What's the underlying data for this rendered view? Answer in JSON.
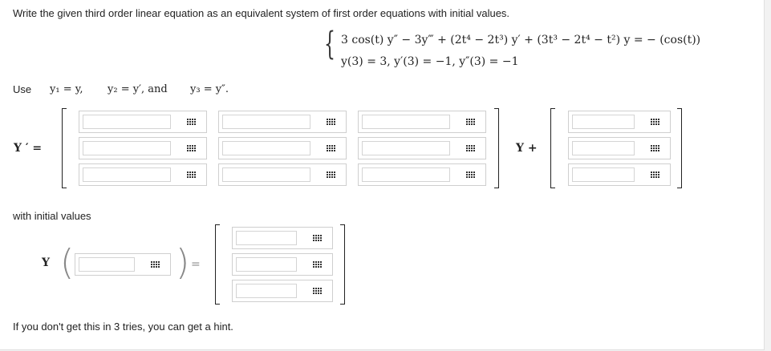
{
  "prompt": "Write the given third order linear equation as an equivalent system of first order equations with initial values.",
  "equation": {
    "line1": "3 cos(t) y″ − 3y‴ + (2t⁴ − 2t³) y′ + (3t³ − 2t⁴ − t²) y = − (cos(t))",
    "line2": "y(3) = 3,   y′(3) = −1,   y″(3) = −1"
  },
  "use": {
    "word": "Use",
    "y1": "y₁ = y,",
    "y2": "y₂ = y′, and",
    "y3": "y₃ = y″."
  },
  "system": {
    "lhs": "Y ′ =",
    "plus_label": "Y +"
  },
  "initial_label": "with initial values",
  "initial": {
    "y_label": "Y",
    "equals": "="
  },
  "hint": "If you don't get this in 3 tries, you can get a hint.",
  "icons": {
    "keyboard": "keyboard-grid-icon"
  }
}
